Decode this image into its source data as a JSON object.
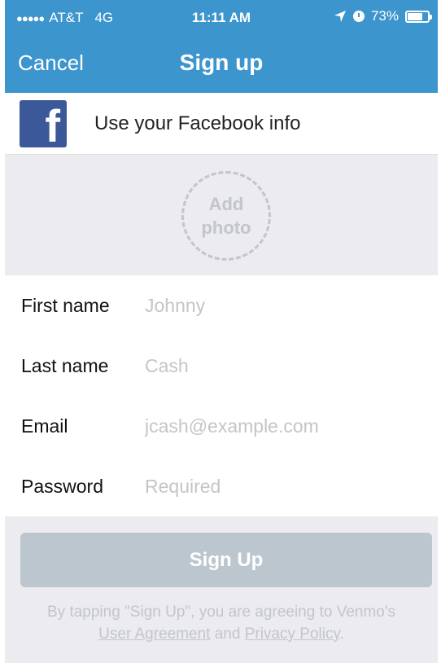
{
  "status_bar": {
    "signal": "●●●●●",
    "carrier": "AT&T",
    "network": "4G",
    "time": "11:11 AM",
    "location_icon": "location-arrow-icon",
    "alarm_icon": "alarm-icon",
    "battery_percent": "73%",
    "battery_level": 0.73
  },
  "nav": {
    "cancel_label": "Cancel",
    "title": "Sign up"
  },
  "facebook": {
    "icon": "facebook-icon",
    "logo_letter": "f",
    "label": "Use your Facebook info",
    "brand_color": "#3b5998"
  },
  "photo": {
    "line1": "Add",
    "line2": "photo"
  },
  "form": {
    "first_name": {
      "label": "First name",
      "value": "",
      "placeholder": "Johnny"
    },
    "last_name": {
      "label": "Last name",
      "value": "",
      "placeholder": "Cash"
    },
    "email": {
      "label": "Email",
      "value": "",
      "placeholder": "jcash@example.com"
    },
    "password": {
      "label": "Password",
      "value": "",
      "placeholder": "Required"
    }
  },
  "signup": {
    "button_label": "Sign Up"
  },
  "terms": {
    "prefix": "By tapping \"Sign Up\", you are agreeing to Venmo's",
    "user_agreement": "User Agreement",
    "and": "and",
    "privacy_policy": "Privacy Policy",
    "period": "."
  },
  "colors": {
    "accent": "#3d95ce",
    "background": "#ebebf0",
    "disabled_button": "#bcc6cf"
  }
}
